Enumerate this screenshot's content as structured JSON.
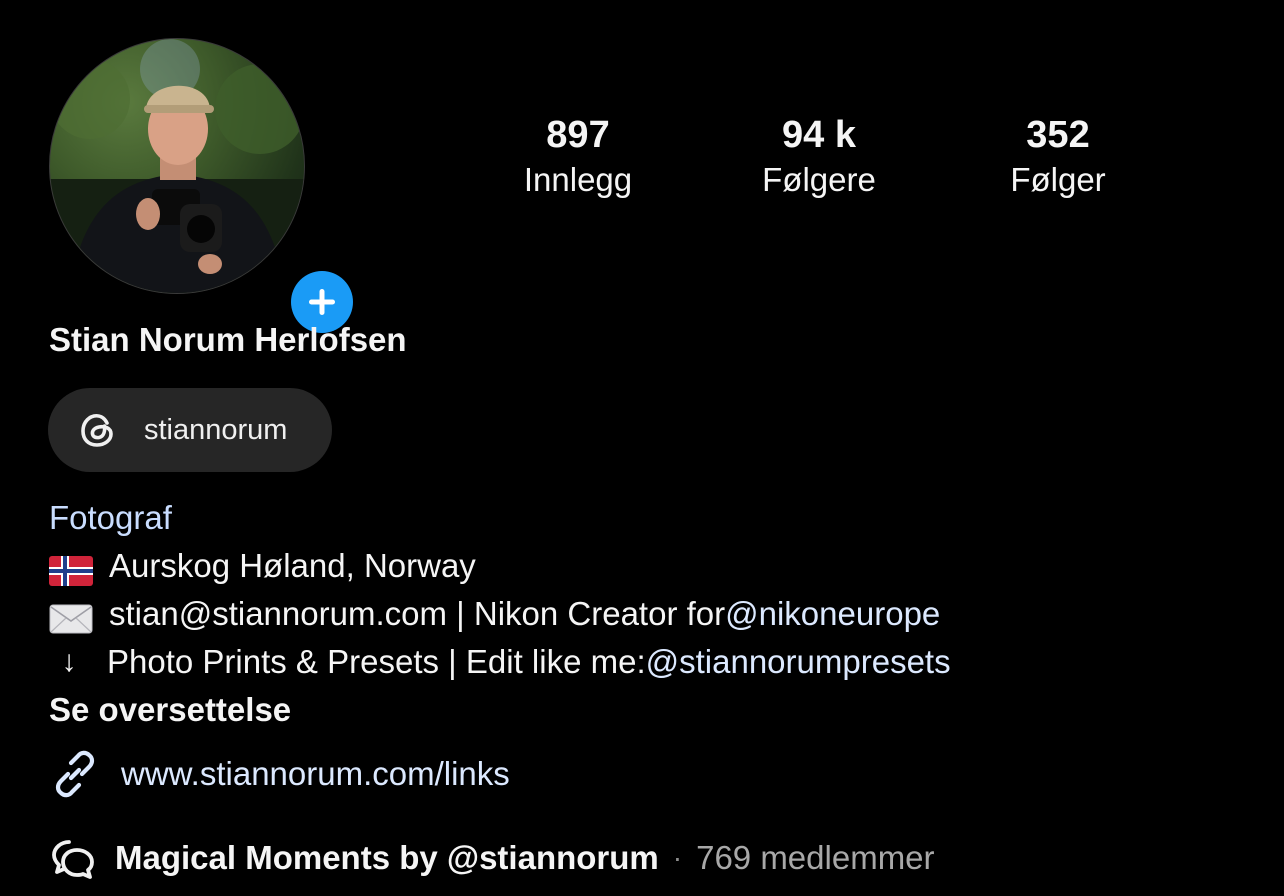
{
  "profile": {
    "full_name": "Stian Norum Herlofsen",
    "avatar_icon": "profile-photo",
    "add_story_icon": "plus-icon"
  },
  "stats": {
    "posts": {
      "value": "897",
      "label": "Innlegg"
    },
    "followers": {
      "value": "94 k",
      "label": "Følgere"
    },
    "following": {
      "value": "352",
      "label": "Følger"
    }
  },
  "threads": {
    "username": "stiannorum",
    "icon": "threads-icon"
  },
  "bio": {
    "category": "Fotograf",
    "location": "Aurskog Høland, Norway",
    "email_line_text": "stian@stiannorum.com | Nikon Creator for ",
    "email_line_mention": "@nikoneurope",
    "arrow_glyph": "↓",
    "presets_line_text": "Photo Prints & Presets | Edit like me: ",
    "presets_line_mention": "@stiannorumpresets",
    "see_translation": "Se oversettelse"
  },
  "link": {
    "url": "www.stiannorum.com/links",
    "icon": "link-icon"
  },
  "channel": {
    "name": "Magical Moments by @stiannorum",
    "separator": "·",
    "members": "769 medlemmer",
    "icon": "broadcast-channel-icon"
  },
  "colors": {
    "background": "#000000",
    "accent_blue": "#1a9bf6",
    "pill_bg": "#262626",
    "link_text": "#dce9ff",
    "muted": "#a8a8a8"
  }
}
